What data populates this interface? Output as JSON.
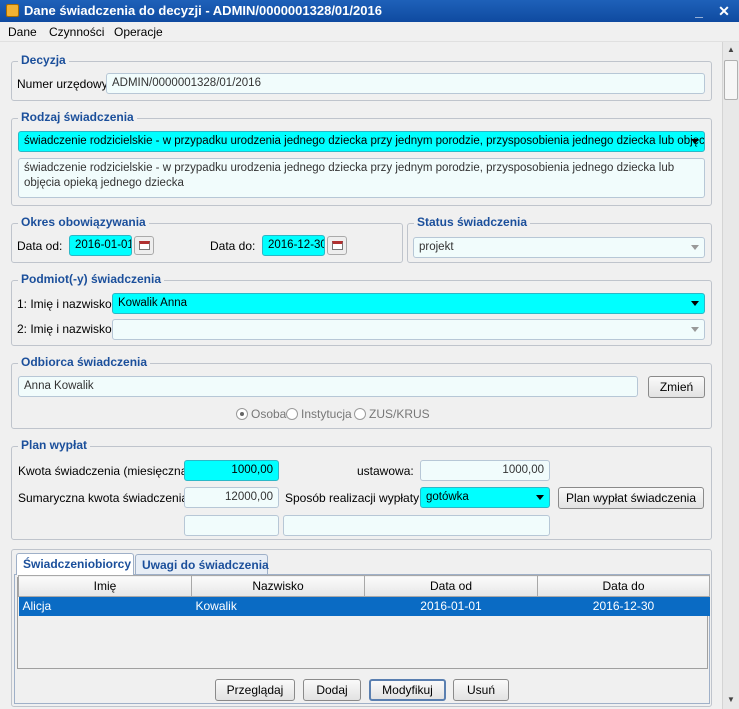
{
  "window": {
    "title": "Dane świadczenia do decyzji - ADMIN/0000001328/01/2016",
    "minimize": "_",
    "close": "✕"
  },
  "menu": [
    "Dane",
    "Czynności",
    "Operacje"
  ],
  "decyzja": {
    "title": "Decyzja",
    "numer_label": "Numer urzędowy:",
    "numer_value": "ADMIN/0000001328/01/2016"
  },
  "rodzaj": {
    "title": "Rodzaj świadczenia",
    "selected": "świadczenie rodzicielskie - w przypadku urodzenia jednego dziecka przy jednym porodzie, przysposobienia jednego dziecka lub objęcia o...",
    "description": "świadczenie rodzicielskie - w przypadku urodzenia jednego dziecka przy jednym porodzie, przysposobienia jednego dziecka lub objęcia opieką jednego dziecka"
  },
  "okres": {
    "title": "Okres obowiązywania",
    "od_label": "Data od:",
    "od_value": "2016-01-01",
    "do_label": "Data do:",
    "do_value": "2016-12-30"
  },
  "status": {
    "title": "Status świadczenia",
    "value": "projekt"
  },
  "podmiot": {
    "title": "Podmiot(-y) świadczenia",
    "row1_label": "1: Imię i nazwisko:",
    "row1_value": "Kowalik Anna",
    "row2_label": "2: Imię i nazwisko:",
    "row2_value": ""
  },
  "odbiorca": {
    "title": "Odbiorca świadczenia",
    "value": "Anna Kowalik",
    "zmien": "Zmień",
    "radios": [
      "Osoba",
      "Instytucja",
      "ZUS/KRUS"
    ],
    "selected_radio": "Osoba"
  },
  "plan": {
    "title": "Plan wypłat",
    "kwota_label": "Kwota świadczenia (miesięczna):",
    "kwota_value": "1000,00",
    "ustawowa_label": "ustawowa:",
    "ustawowa_value": "1000,00",
    "suma_label": "Sumaryczna kwota świadczenia:",
    "suma_value": "12000,00",
    "sposob_label": "Sposób realizacji wypłaty:",
    "sposob_value": "gotówka",
    "plan_button": "Plan wypłat świadczenia",
    "extra1": "",
    "extra2": ""
  },
  "tabs": [
    "Świadczeniobiorcy",
    "Uwagi do świadczenia"
  ],
  "grid": {
    "headers": [
      "Imię",
      "Nazwisko",
      "Data od",
      "Data do"
    ],
    "rows": [
      {
        "imie": "Alicja",
        "nazwisko": "Kowalik",
        "data_od": "2016-01-01",
        "data_do": "2016-12-30"
      }
    ]
  },
  "buttons": {
    "przegladaj": "Przeglądaj",
    "dodaj": "Dodaj",
    "modyfikuj": "Modyfikuj",
    "usun": "Usuń"
  }
}
